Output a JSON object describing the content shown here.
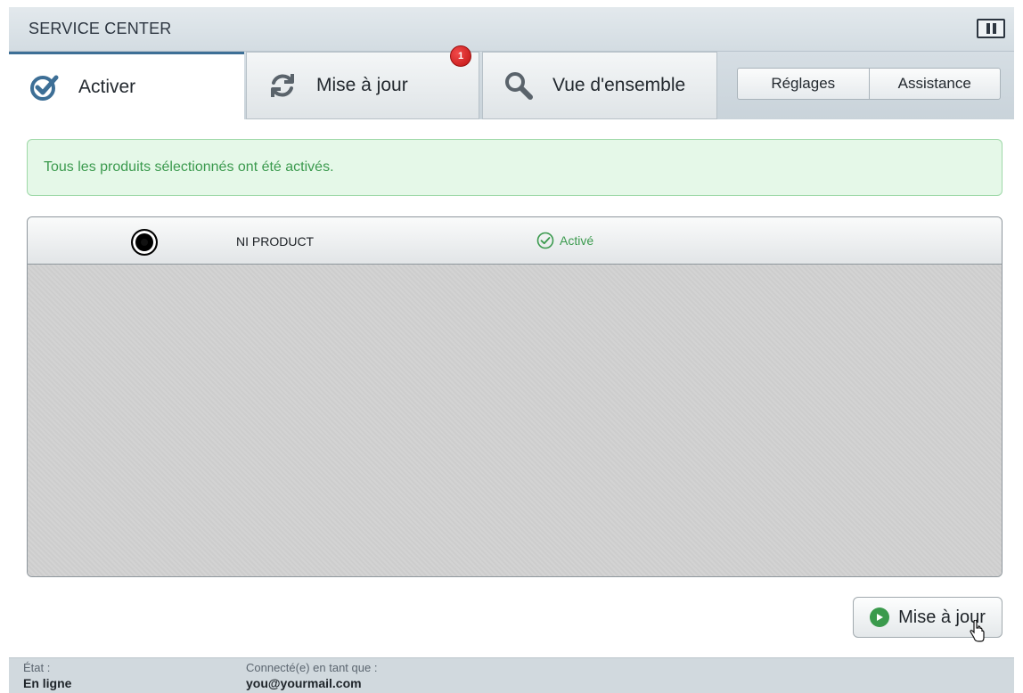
{
  "app": {
    "title": "SERVICE CENTER"
  },
  "tabs": [
    {
      "label": "Activer",
      "icon": "checkmark-icon",
      "active": true
    },
    {
      "label": "Mise à jour",
      "icon": "refresh-icon",
      "badge": "1"
    },
    {
      "label": "Vue d'ensemble",
      "icon": "search-icon"
    }
  ],
  "header_buttons": {
    "settings": "Réglages",
    "support": "Assistance"
  },
  "banner": {
    "message": "Tous les produits sélectionnés ont été activés.",
    "color": "#3b9a4e"
  },
  "products": [
    {
      "name": "NI PRODUCT",
      "status": "Activé",
      "selected": true
    }
  ],
  "actions": {
    "update_label": "Mise à jour"
  },
  "statusbar": {
    "state_label": "État :",
    "state_value": "En ligne",
    "user_label": "Connecté(e) en tant que :",
    "user_value": "you@yourmail.com"
  },
  "colors": {
    "accent": "#3d6f96",
    "success": "#3b9a4e",
    "badge": "#d11a1a"
  }
}
